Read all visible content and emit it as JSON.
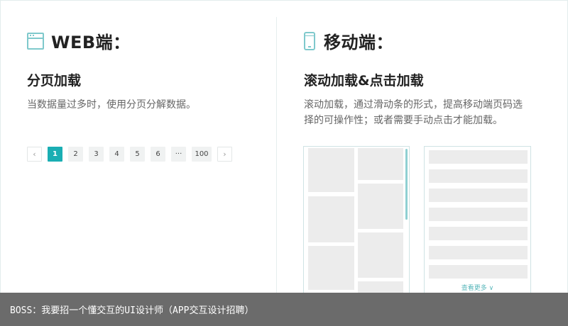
{
  "web": {
    "icon": "browser-window-icon",
    "title": "WEB端：",
    "subtitle": "分页加载",
    "description": "当数据量过多时，使用分页分解数据。",
    "pagination": {
      "prev": "‹",
      "pages": [
        "1",
        "2",
        "3",
        "4",
        "5",
        "6",
        "···",
        "100"
      ],
      "active": "1",
      "next": "›"
    }
  },
  "mobile": {
    "icon": "mobile-phone-icon",
    "title": "移动端：",
    "subtitle": "滚动加载&点击加载",
    "description_line1": "滚动加载，通过滑动条的形式，提高移动端页码选",
    "description_line2": "择的可操作性；或者需要手动点击才能加载。",
    "load_more": "查看更多 ∨"
  },
  "caption": "BOSS：我要招一个懂交互的UI设计师（APP交互设计招聘）",
  "colors": {
    "accent": "#1aaeb3",
    "icon": "#7fc9cc",
    "caption_bg": "#6b6b6b"
  }
}
